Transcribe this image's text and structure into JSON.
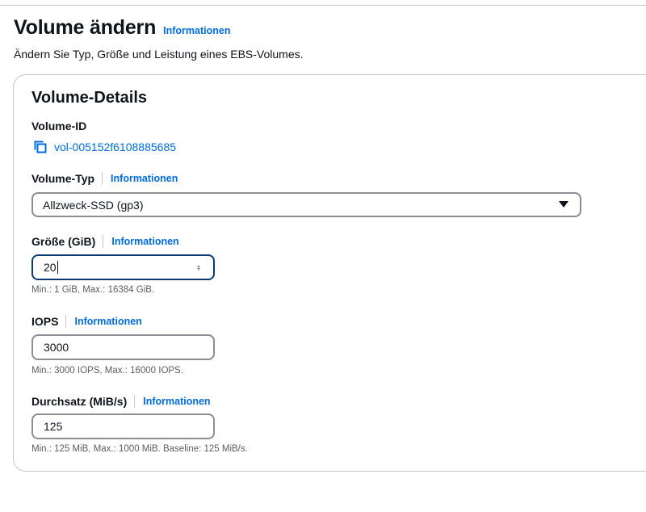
{
  "header": {
    "title": "Volume ändern",
    "info_link": "Informationen",
    "description": "Ändern Sie Typ, Größe und Leistung eines EBS-Volumes."
  },
  "card": {
    "title": "Volume-Details",
    "volume_id": {
      "label": "Volume-ID",
      "value": "vol-005152f6108885685",
      "icon": "copy-icon"
    },
    "volume_type": {
      "label": "Volume-Typ",
      "info_link": "Informationen",
      "selected": "Allzweck-SSD (gp3)"
    },
    "size": {
      "label": "Größe (GiB)",
      "info_link": "Informationen",
      "value": "20",
      "hint": "Min.: 1 GiB, Max.: 16384 GiB."
    },
    "iops": {
      "label": "IOPS",
      "info_link": "Informationen",
      "value": "3000",
      "hint": "Min.: 3000 IOPS, Max.: 16000 IOPS."
    },
    "throughput": {
      "label": "Durchsatz (MiB/s)",
      "info_link": "Informationen",
      "value": "125",
      "hint": "Min.: 125 MiB, Max.: 1000 MiB. Baseline: 125 MiB/s."
    }
  },
  "colors": {
    "link": "#006ce0",
    "text": "#0f141a",
    "border": "#8c8c94",
    "focus_border": "#0a3a6e",
    "hint": "#5b5d64"
  }
}
